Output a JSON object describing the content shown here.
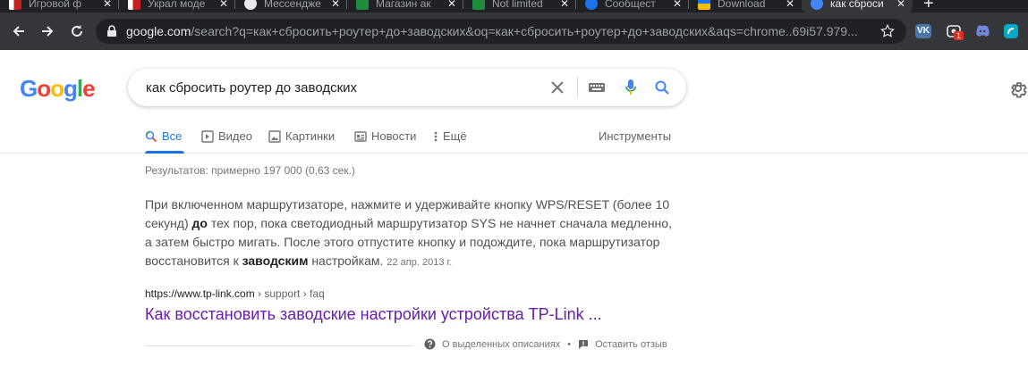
{
  "browser": {
    "tabs": [
      {
        "title": "Игровой ф",
        "color": "#c5221f"
      },
      {
        "title": "Украл моде",
        "color": "#c5221f"
      },
      {
        "title": "Мессендже",
        "color": "#e8eaed"
      },
      {
        "title": "Магазин ак",
        "color": "#1e8e3e"
      },
      {
        "title": "Not limited",
        "color": "#1e8e3e"
      },
      {
        "title": "Сообщест",
        "color": "#1a73e8"
      },
      {
        "title": "Download",
        "color": "#fbbc04"
      },
      {
        "title": "как сброси",
        "color": "#4285f4"
      }
    ],
    "url_host": "google.com",
    "url_path": "/search?q=как+сбросить+роутер+до+заводских&oq=как+сбросить+роутер+до+заводских&aqs=chrome..69i57.979...",
    "extension_badge": "1",
    "extension_vk": "VK"
  },
  "search": {
    "logo": [
      "G",
      "o",
      "o",
      "g",
      "l",
      "e"
    ],
    "query": "как сбросить роутер до заводских"
  },
  "nav": {
    "all": "Все",
    "video": "Видео",
    "images": "Картинки",
    "news": "Новости",
    "more": "Ещё",
    "tools": "Инструменты"
  },
  "results": {
    "stats": "Результатов: примерно 197 000 (0,63 сек.)",
    "snippet": {
      "p1": "При включенном маршрутизаторе, нажмите и удерживайте кнопку WPS/RESET (более 10 секунд) ",
      "b1": "до",
      "p2": " тех пор, пока светодиодный маршрутизатор SYS не начнет сначала медленно, а затем быстро мигать. После этого отпустите кнопку и подождите, пока маршрутизатор восстановится к ",
      "b2": "заводским",
      "p3": " настройкам.",
      "date": "22 апр. 2013 г."
    },
    "cite_host": "https://www.tp-link.com",
    "cite_path": " › support › faq",
    "title": "Как восстановить заводские настройки устройства TP-Link ..."
  },
  "feedback": {
    "about": "О выделенных описаниях",
    "dot": "•",
    "send": "Оставить отзыв"
  },
  "colors": {
    "google_blue": "#4285f4",
    "google_red": "#ea4335",
    "google_yellow": "#fbbc05",
    "google_green": "#34a853",
    "link_visited": "#681da8",
    "tab_active_blue": "#1a73e8"
  }
}
